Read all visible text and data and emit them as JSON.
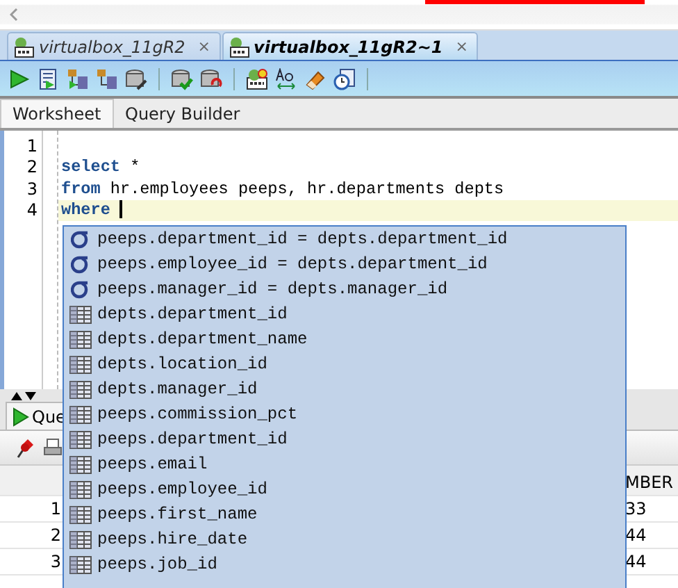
{
  "connection_tabs": [
    {
      "label": "virtualbox_11gR2",
      "selected": false,
      "close": "×"
    },
    {
      "label": "virtualbox_11gR2~1",
      "selected": true,
      "close": "×"
    }
  ],
  "editor_tabs": [
    {
      "label": "Worksheet",
      "selected": true
    },
    {
      "label": "Query Builder",
      "selected": false
    }
  ],
  "editor": {
    "lines": [
      {
        "number": "1",
        "current": false
      },
      {
        "number": "2",
        "current": false,
        "tokens": [
          {
            "kind": "keyword",
            "text": "select"
          },
          {
            "kind": "text",
            "text": " *"
          }
        ]
      },
      {
        "number": "3",
        "current": false,
        "tokens": [
          {
            "kind": "keyword",
            "text": "from"
          },
          {
            "kind": "text",
            "text": " hr.employees peeps, hr.departments depts"
          }
        ]
      },
      {
        "number": "4",
        "current": true,
        "tokens": [
          {
            "kind": "keyword",
            "text": "where"
          }
        ]
      }
    ]
  },
  "results": {
    "tab_label": "Que",
    "column_header": "MBER",
    "rows": [
      {
        "number": "1",
        "value": "33"
      },
      {
        "number": "2",
        "value": "44"
      },
      {
        "number": "3",
        "value": "44"
      }
    ]
  },
  "autocomplete": {
    "items": [
      {
        "kind": "join",
        "text": "peeps.department_id = depts.department_id"
      },
      {
        "kind": "join",
        "text": "peeps.employee_id = depts.department_id"
      },
      {
        "kind": "join",
        "text": "peeps.manager_id = depts.manager_id"
      },
      {
        "kind": "column",
        "text": "depts.department_id"
      },
      {
        "kind": "column",
        "text": "depts.department_name"
      },
      {
        "kind": "column",
        "text": "depts.location_id"
      },
      {
        "kind": "column",
        "text": "depts.manager_id"
      },
      {
        "kind": "column",
        "text": "peeps.commission_pct"
      },
      {
        "kind": "column",
        "text": "peeps.department_id"
      },
      {
        "kind": "column",
        "text": "peeps.email"
      },
      {
        "kind": "column",
        "text": "peeps.employee_id"
      },
      {
        "kind": "column",
        "text": "peeps.first_name"
      },
      {
        "kind": "column",
        "text": "peeps.hire_date"
      },
      {
        "kind": "column",
        "text": "peeps.job_id"
      }
    ]
  }
}
